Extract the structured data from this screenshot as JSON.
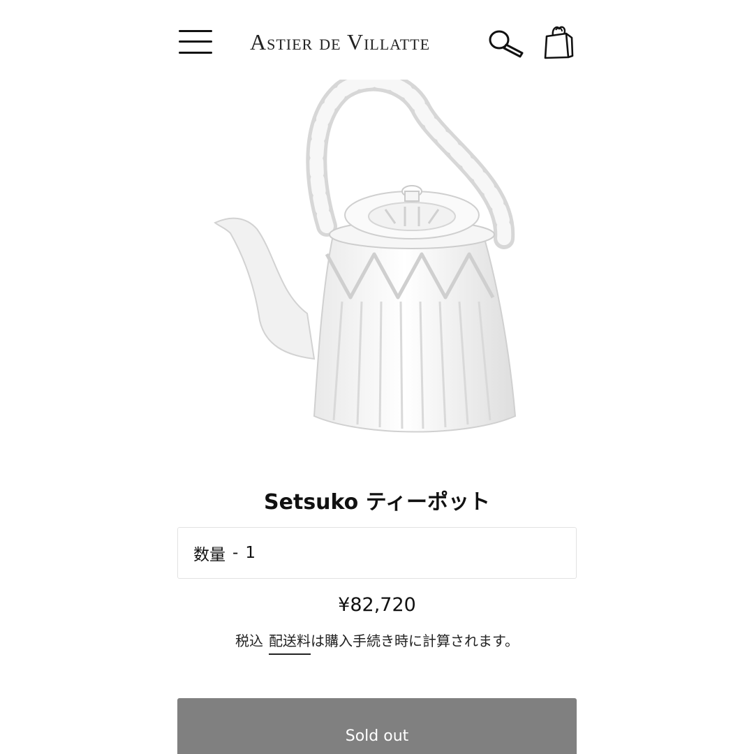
{
  "header": {
    "logo_text": "Astier de Villatte",
    "icons": {
      "menu": "hamburger-menu-icon",
      "search": "magnifier-icon",
      "cart": "shopping-bag-icon"
    }
  },
  "product": {
    "image_icon": "setsuko-teapot-image",
    "title": "Setsuko ティーポット",
    "quantity": {
      "label": "数量",
      "separator": "-",
      "value": "1"
    },
    "price": "¥82,720",
    "tax_note": {
      "prefix": "税込",
      "link_text": "配送料",
      "suffix": "は購入手続き時に計算されます。"
    },
    "button_label": "Sold out"
  },
  "colors": {
    "button_bg": "#808080",
    "button_text": "#ffffff",
    "text": "#111111",
    "border": "#e2e2e2"
  }
}
